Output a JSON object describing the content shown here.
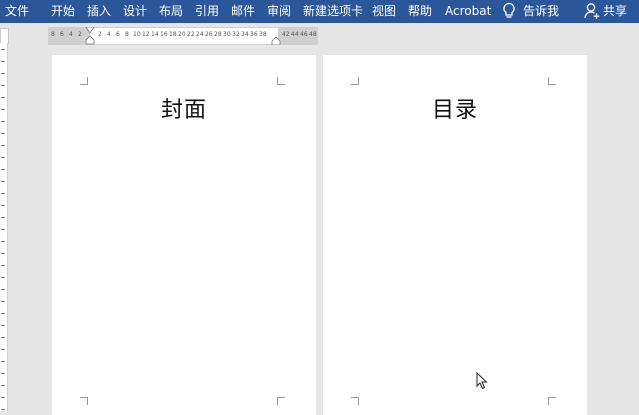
{
  "ribbon": {
    "tabs": [
      "文件",
      "开始",
      "插入",
      "设计",
      "布局",
      "引用",
      "邮件",
      "审阅",
      "新建选项卡",
      "视图",
      "帮助",
      "Acrobat"
    ],
    "tell_me": "告诉我",
    "share": "共享"
  },
  "ruler": {
    "ticks": [
      "8",
      "6",
      "4",
      "2",
      "2",
      "4",
      "6",
      "8",
      "10",
      "12",
      "14",
      "16",
      "18",
      "20",
      "22",
      "24",
      "26",
      "28",
      "30",
      "32",
      "34",
      "36",
      "38",
      "42",
      "44",
      "46",
      "48"
    ]
  },
  "pages": [
    {
      "heading": "封面"
    },
    {
      "heading": "目录"
    }
  ],
  "colors": {
    "ribbon": "#2b579a",
    "workspace": "#e6e6e6",
    "page": "#ffffff"
  }
}
